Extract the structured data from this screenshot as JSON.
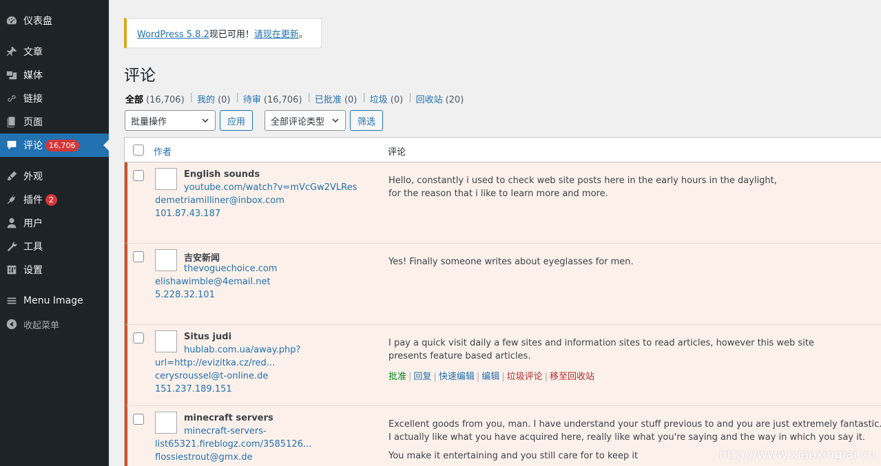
{
  "sidebar": {
    "items": [
      {
        "label": "仪表盘",
        "icon": "dashboard-icon"
      },
      {
        "label": "文章",
        "icon": "pin-icon"
      },
      {
        "label": "媒体",
        "icon": "media-icon"
      },
      {
        "label": "链接",
        "icon": "link-icon"
      },
      {
        "label": "页面",
        "icon": "page-icon"
      },
      {
        "label": "评论",
        "icon": "comment-icon",
        "badge": "16,706",
        "current": true
      },
      {
        "label": "外观",
        "icon": "brush-icon"
      },
      {
        "label": "插件",
        "icon": "plugin-icon",
        "badge": "2"
      },
      {
        "label": "用户",
        "icon": "user-icon"
      },
      {
        "label": "工具",
        "icon": "wrench-icon"
      },
      {
        "label": "设置",
        "icon": "settings-icon"
      },
      {
        "label": "Menu Image",
        "icon": "menu-icon"
      },
      {
        "label": "收起菜单",
        "icon": "collapse-icon"
      }
    ]
  },
  "notice": {
    "link1": "WordPress 5.8.2",
    "text": "现已可用！",
    "link2": "请现在更新",
    "end": "。"
  },
  "page_title": "评论",
  "filters": [
    {
      "label": "全部",
      "count": "(16,706)",
      "current": true
    },
    {
      "label": "我的",
      "count": "(0)"
    },
    {
      "label": "待审",
      "count": "(16,706)"
    },
    {
      "label": "已批准",
      "count": "(0)"
    },
    {
      "label": "垃圾",
      "count": "(0)"
    },
    {
      "label": "回收站",
      "count": "(20)"
    }
  ],
  "toolbar": {
    "bulk_label": "批量操作",
    "apply_label": "应用",
    "type_label": "全部评论类型",
    "filter_label": "筛选"
  },
  "table": {
    "col_author": "作者",
    "col_comment": "评论",
    "rows": [
      {
        "name": "English sounds",
        "lines": [
          "youtube.com/watch?v=mVcGw2VLRes",
          "demetriamilliner@inbox.com",
          "101.87.43.187"
        ],
        "comment": [
          "Hello, constantly i used to check web site posts here in the early hours in the daylight,",
          "for the reason that i like to learn more and more."
        ]
      },
      {
        "name": "吉安新闻",
        "lines": [
          "thevoguechoice.com",
          "elishawimble@4email.net",
          "5.228.32.101"
        ],
        "comment": [
          "Yes! Finally someone writes about eyeglasses for men."
        ]
      },
      {
        "name": "Situs judi",
        "lines": [
          "hublab.com.ua/away.php?",
          "url=http://evizitka.cz/red...",
          "cerysroussel@t-online.de",
          "151.237.189.151"
        ],
        "comment": [
          "I pay a quick visit daily a few sites and information sites to read articles, however this web site",
          "presents feature based articles."
        ],
        "actions": [
          "批准",
          "回复",
          "快速编辑",
          "编辑",
          "垃圾评论",
          "移至回收站"
        ]
      },
      {
        "name": "minecraft servers",
        "lines": [
          "minecraft-servers-",
          "list65321.fireblogz.com/3585126...",
          "flossiestrout@gmx.de"
        ],
        "comment": [
          "Excellent goods from you, man. I have understand your stuff previous to and you are just extremely fantastic.",
          "I actually like what you have acquired here, really like what you're saying and the way in which you say it.",
          "You make it entertaining and you still care for to keep it"
        ]
      }
    ]
  },
  "watermark": "http://www.xiaoxingiai.cn"
}
